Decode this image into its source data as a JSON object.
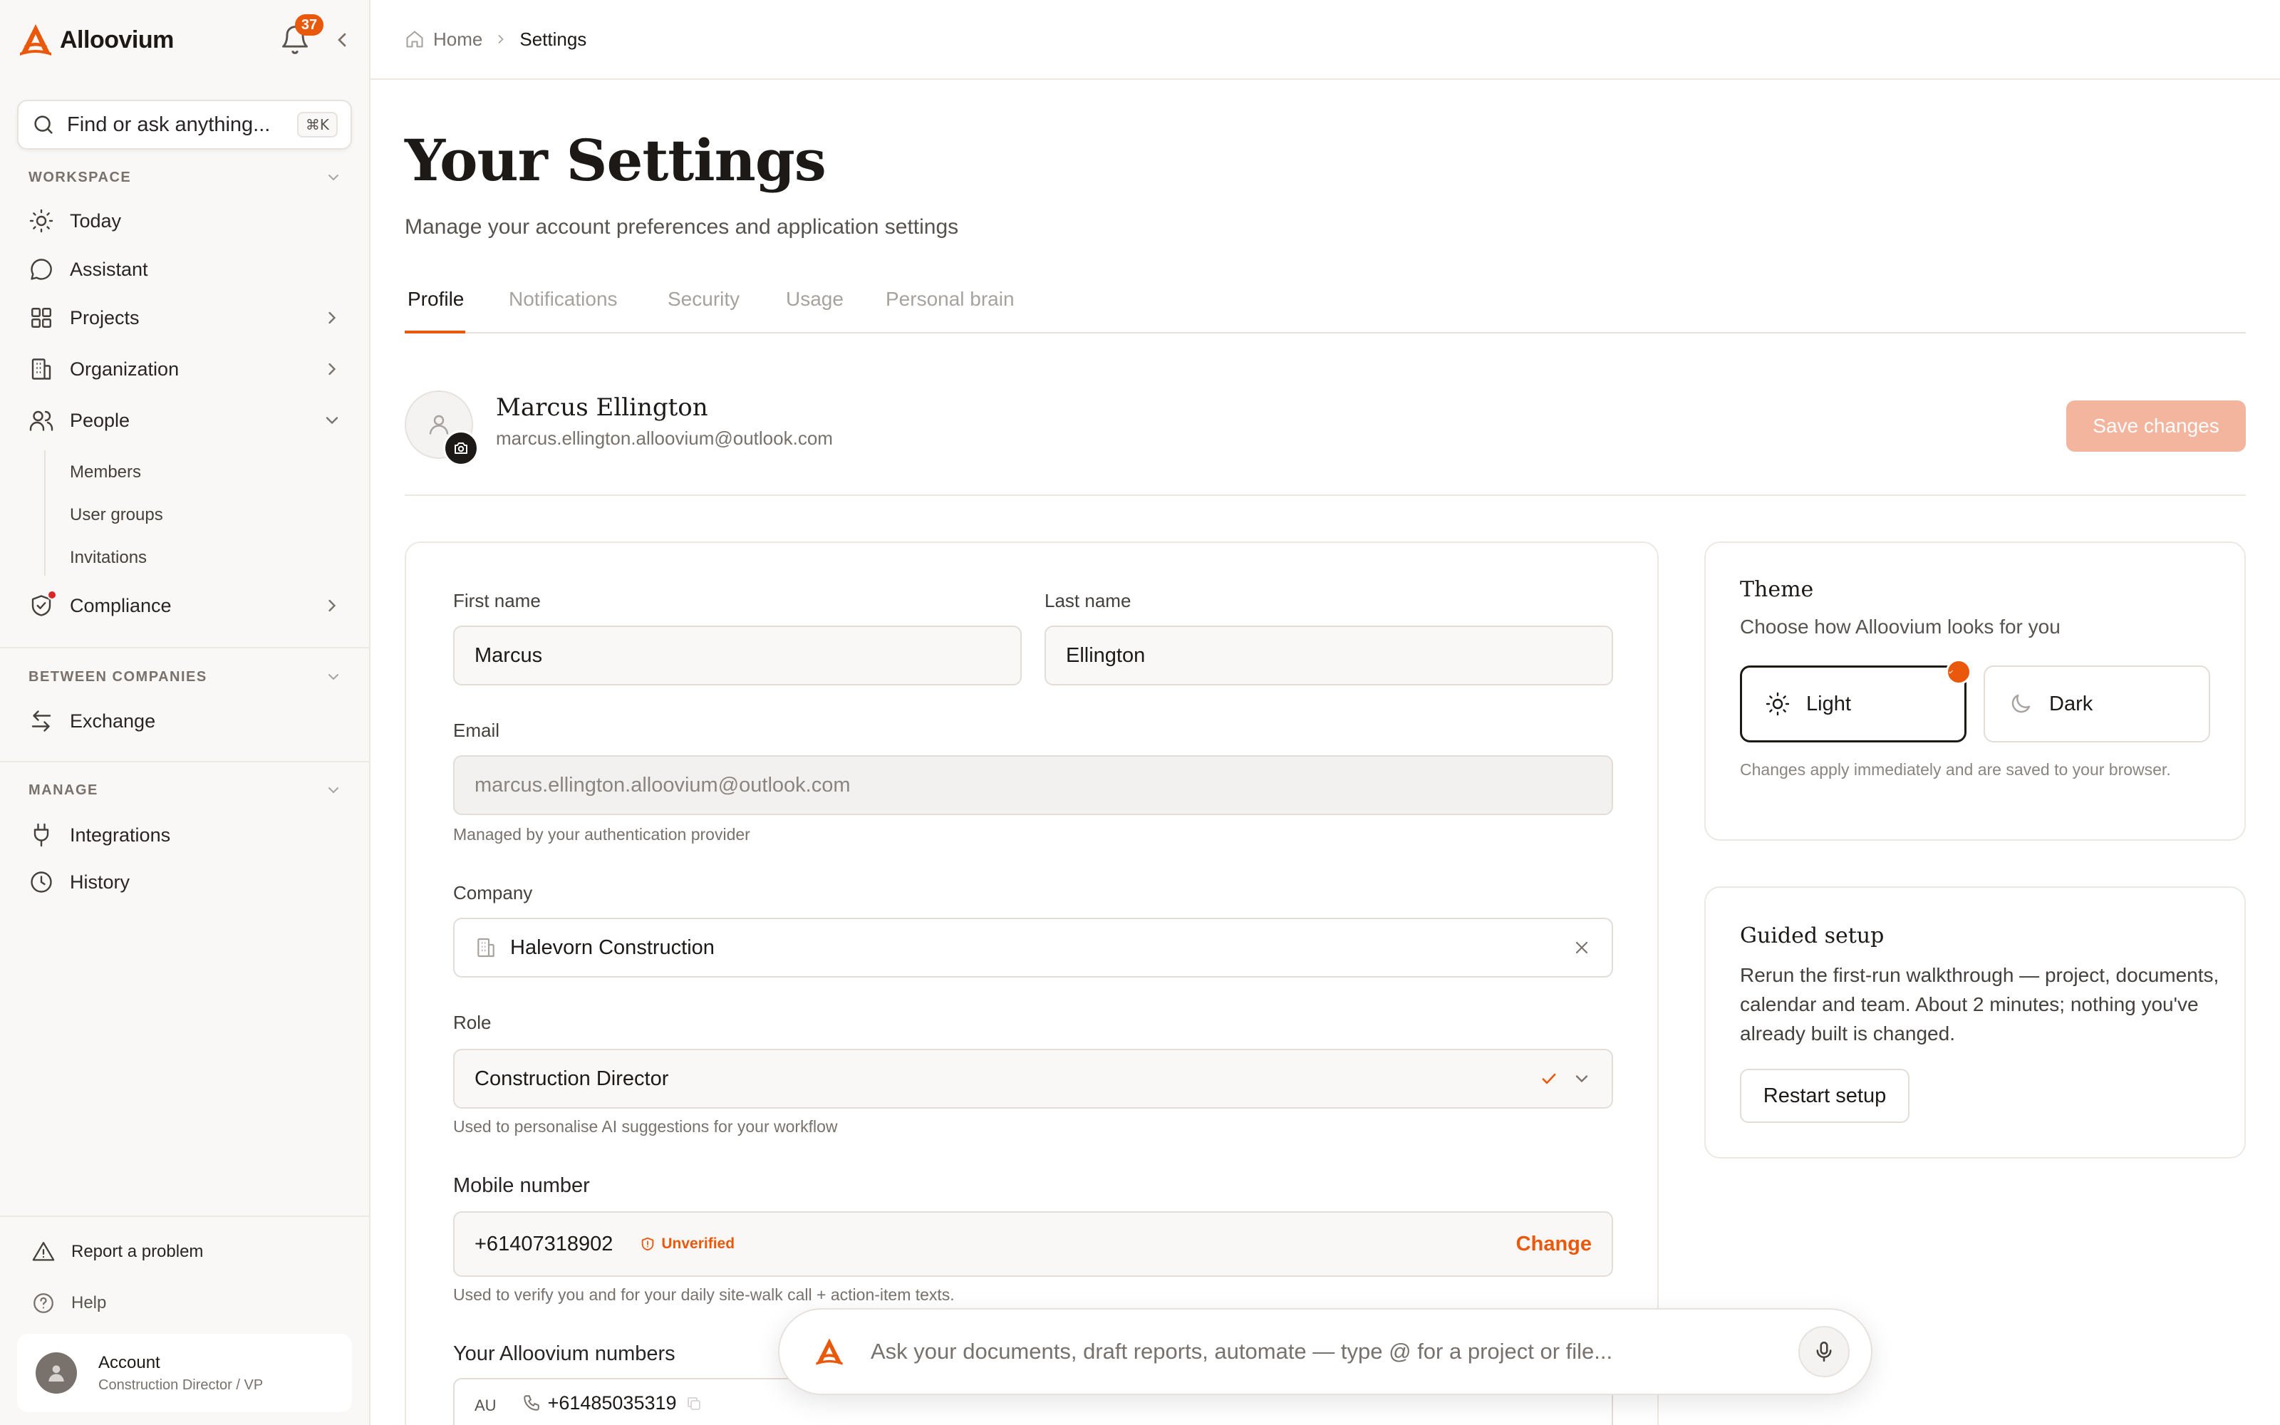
{
  "brand": {
    "name": "Alloovium",
    "accent": "#ea580c"
  },
  "notifications": {
    "count": "37"
  },
  "search": {
    "placeholder": "Find or ask anything...",
    "shortcut": "⌘K"
  },
  "sidebar": {
    "sections": {
      "workspace": "WORKSPACE",
      "between": "BETWEEN COMPANIES",
      "manage": "MANAGE"
    },
    "items": {
      "today": "Today",
      "assistant": "Assistant",
      "projects": "Projects",
      "organization": "Organization",
      "people": "People",
      "members": "Members",
      "user_groups": "User groups",
      "invitations": "Invitations",
      "compliance": "Compliance",
      "exchange": "Exchange",
      "integrations": "Integrations",
      "history": "History"
    },
    "bottom": {
      "report": "Report a problem",
      "help": "Help"
    },
    "account": {
      "name": "Account",
      "role": "Construction Director / VP"
    }
  },
  "breadcrumb": {
    "home": "Home",
    "current": "Settings"
  },
  "page": {
    "title": "Your Settings",
    "subtitle": "Manage your account preferences and application settings"
  },
  "tabs": [
    "Profile",
    "Notifications",
    "Security",
    "Usage",
    "Personal brain"
  ],
  "profile": {
    "name": "Marcus Ellington",
    "email": "marcus.ellington.alloovium@outlook.com",
    "save_label": "Save changes"
  },
  "form": {
    "first_name_label": "First name",
    "first_name": "Marcus",
    "last_name_label": "Last name",
    "last_name": "Ellington",
    "email_label": "Email",
    "email": "marcus.ellington.alloovium@outlook.com",
    "email_help": "Managed by your authentication provider",
    "company_label": "Company",
    "company": "Halevorn Construction",
    "role_label": "Role",
    "role": "Construction Director",
    "role_help": "Used to personalise AI suggestions for your workflow",
    "mobile_label": "Mobile number",
    "mobile": "+61407318902",
    "mobile_status": "Unverified",
    "mobile_change": "Change",
    "mobile_help": "Used to verify you and for your daily site-walk call + action-item texts.",
    "numbers_label": "Your Alloovium numbers",
    "number_country": "AU",
    "number": "+61485035319"
  },
  "theme": {
    "title": "Theme",
    "subtitle": "Choose how Alloovium looks for you",
    "light": "Light",
    "dark": "Dark",
    "selected": "light",
    "note": "Changes apply immediately and are saved to your browser."
  },
  "guided": {
    "title": "Guided setup",
    "body": "Rerun the first-run walkthrough — project, documents, calendar and team. About 2 minutes; nothing you've already built is changed.",
    "button": "Restart setup"
  },
  "assistant_bar": {
    "placeholder": "Ask your documents, draft reports, automate — type @ for a project or file..."
  }
}
